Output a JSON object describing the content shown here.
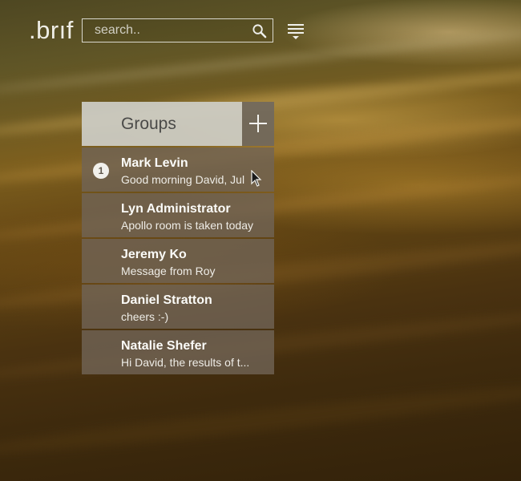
{
  "app": {
    "logo": ".brıf"
  },
  "header": {
    "search_placeholder": "search..",
    "search_icon": "search-icon",
    "menu_icon": "menu-icon"
  },
  "panel": {
    "title": "Groups",
    "add_icon": "plus-icon",
    "items": [
      {
        "name": "Mark Levin",
        "preview": "Good morning David, Jul",
        "unread": "1"
      },
      {
        "name": "Lyn Administrator",
        "preview": "Apollo room is taken today"
      },
      {
        "name": "Jeremy Ko",
        "preview": "Message from Roy"
      },
      {
        "name": "Daniel Stratton",
        "preview": "cheers :-)"
      },
      {
        "name": "Natalie Shefer",
        "preview": "Hi David, the results of t..."
      }
    ]
  },
  "colors": {
    "tab_bg": "#cecdc6",
    "item_bg": "#706456",
    "text_light": "#fbfbf8"
  }
}
